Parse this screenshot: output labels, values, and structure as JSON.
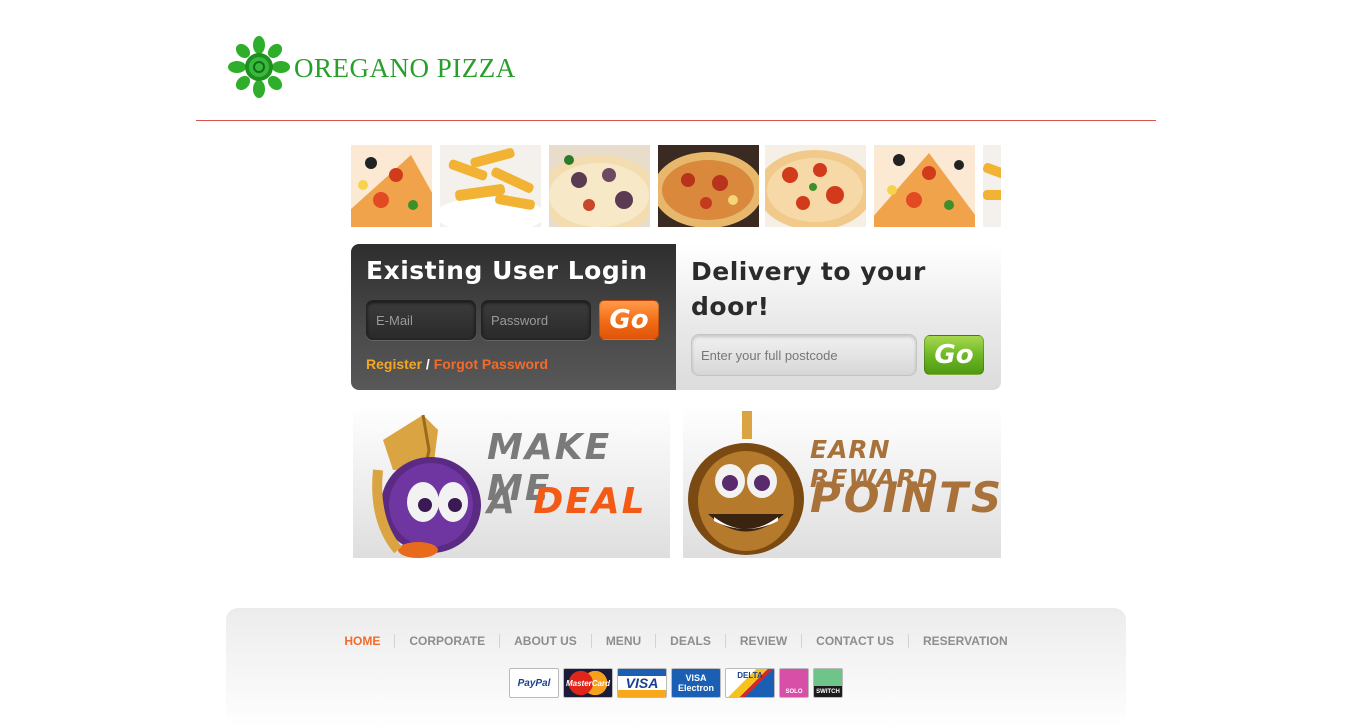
{
  "header": {
    "brand": "OREGANO PIZZA"
  },
  "login": {
    "title": "Existing User Login",
    "email_placeholder": "E-Mail",
    "password_placeholder": "Password",
    "go_label": "Go",
    "register_label": "Register",
    "separator": "/",
    "forgot_label": "Forgot Password"
  },
  "delivery": {
    "title": "Delivery to your door!",
    "postcode_placeholder": "Enter your full postcode",
    "go_label": "Go"
  },
  "promos": {
    "deal_line1": "MAKE ME",
    "deal_line2_a": "A",
    "deal_line2_b": "DEAL",
    "reward_line1": "EARN REWARD",
    "reward_line2": "POINTS"
  },
  "footer": {
    "nav": [
      "HOME",
      "CORPORATE",
      "ABOUT US",
      "MENU",
      "DEALS",
      "REVIEW",
      "CONTACT US",
      "RESERVATION"
    ],
    "payments": [
      "PayPal",
      "MasterCard",
      "VISA",
      "VISA Electron",
      "DELTA",
      "SOLO",
      "SWITCH"
    ]
  },
  "colors": {
    "brand_green": "#27a02b",
    "accent_orange": "#f26b2a",
    "header_rule": "#d9534f"
  }
}
